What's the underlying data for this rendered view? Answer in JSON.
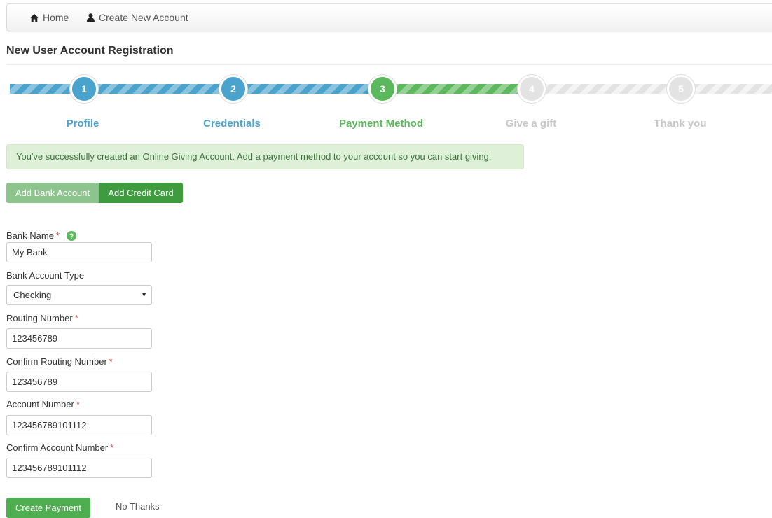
{
  "breadcrumb": {
    "home_label": "Home",
    "create_label": "Create New Account"
  },
  "page_title": "New User Account Registration",
  "wizard": {
    "steps": [
      {
        "number": "1",
        "label": "Profile",
        "state": "done"
      },
      {
        "number": "2",
        "label": "Credentials",
        "state": "done"
      },
      {
        "number": "3",
        "label": "Payment Method",
        "state": "active"
      },
      {
        "number": "4",
        "label": "Give a gift",
        "state": "todo"
      },
      {
        "number": "5",
        "label": "Thank you",
        "state": "todo"
      }
    ]
  },
  "alert_message": "You've successfully created an Online Giving Account. Add a payment method to your account so you can start giving.",
  "payment_tabs": {
    "bank_label": "Add Bank Account",
    "card_label": "Add Credit Card"
  },
  "form": {
    "bank_name": {
      "label": "Bank Name",
      "value": "My Bank",
      "required": "*"
    },
    "account_type": {
      "label": "Bank Account Type",
      "value": "Checking"
    },
    "routing_number": {
      "label": "Routing Number",
      "value": "123456789",
      "required": "*"
    },
    "confirm_routing_number": {
      "label": "Confirm Routing Number",
      "value": "123456789",
      "required": "*"
    },
    "account_number": {
      "label": "Account Number",
      "value": "123456789101112",
      "required": "*"
    },
    "confirm_account_number": {
      "label": "Confirm Account Number",
      "value": "123456789101112",
      "required": "*"
    }
  },
  "actions": {
    "create_label": "Create Payment",
    "no_thanks_label": "No Thanks"
  },
  "colors": {
    "done": "#4aa3cc",
    "active": "#5cb85c",
    "todo": "#e3e3e3",
    "required": "#d9534f"
  }
}
